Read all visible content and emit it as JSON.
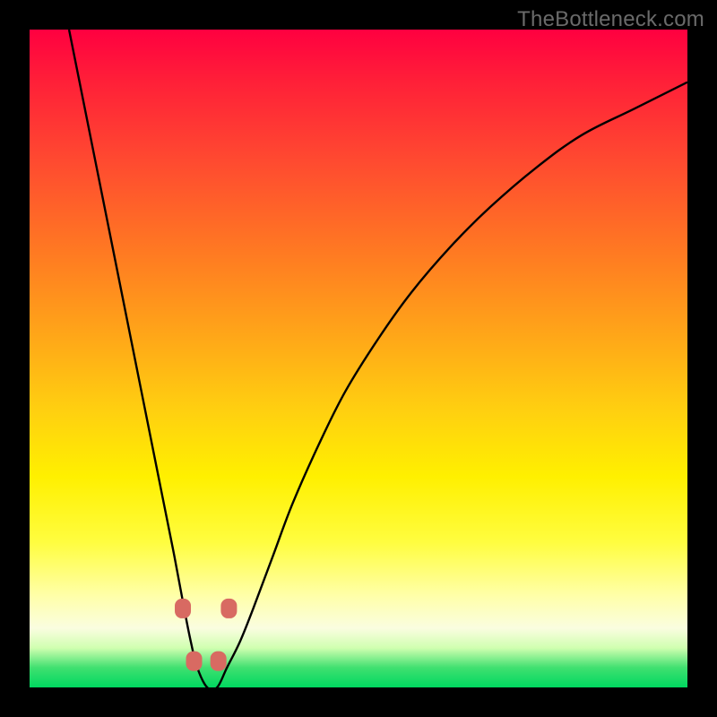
{
  "watermark": {
    "text": "TheBottleneck.com"
  },
  "chart_data": {
    "type": "line",
    "title": "",
    "xlabel": "",
    "ylabel": "",
    "ylim": [
      0,
      100
    ],
    "xlim": [
      0,
      100
    ],
    "series": [
      {
        "name": "bottleneck-curve",
        "x": [
          6,
          8,
          10,
          12,
          14,
          16,
          18,
          20,
          22,
          23.5,
          24.5,
          25.5,
          27,
          28.5,
          30,
          32,
          34,
          37,
          40,
          44,
          48,
          53,
          58,
          64,
          70,
          77,
          84,
          92,
          100
        ],
        "y": [
          100,
          90,
          80,
          70,
          60,
          50,
          40,
          30,
          20,
          12,
          7,
          3,
          0,
          0,
          3,
          7,
          12,
          20,
          28,
          37,
          45,
          53,
          60,
          67,
          73,
          79,
          84,
          88,
          92
        ]
      }
    ],
    "markers": [
      {
        "x": 23.3,
        "y": 12
      },
      {
        "x": 30.3,
        "y": 12
      },
      {
        "x": 25.0,
        "y": 4
      },
      {
        "x": 28.7,
        "y": 4
      }
    ],
    "background_gradient": [
      {
        "pos": 0,
        "color": "#ff0040"
      },
      {
        "pos": 50,
        "color": "#ffc000"
      },
      {
        "pos": 80,
        "color": "#ffff60"
      },
      {
        "pos": 100,
        "color": "#00d860"
      }
    ]
  }
}
